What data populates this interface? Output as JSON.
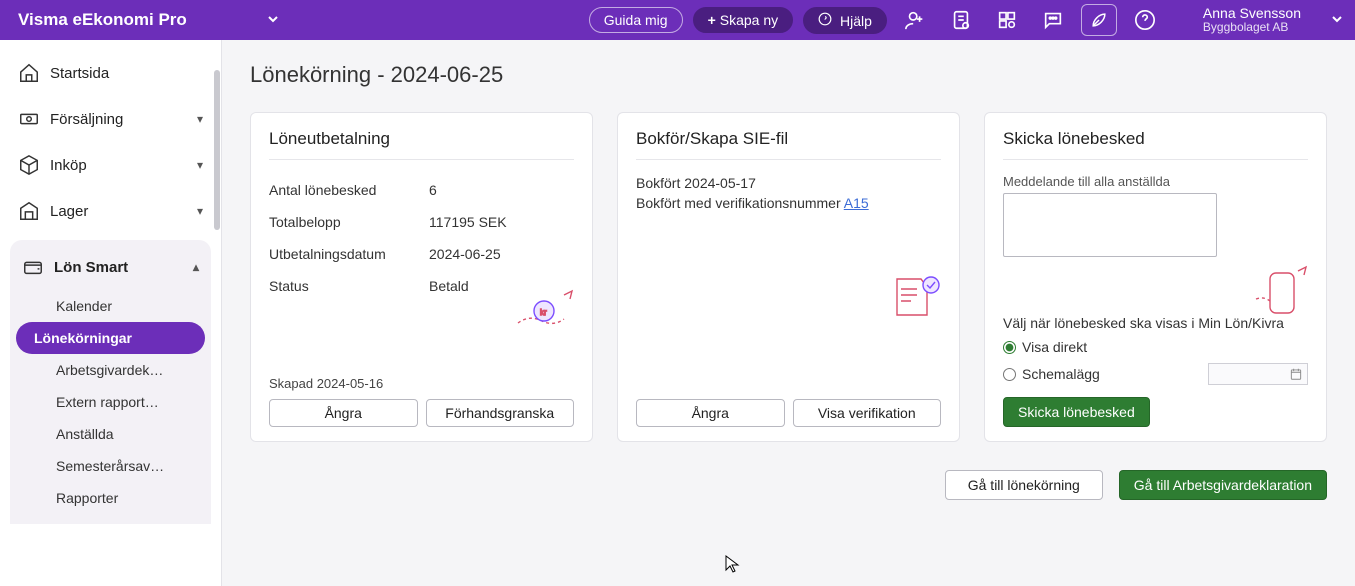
{
  "topbar": {
    "brand": "Visma eEkonomi Pro",
    "guide_btn": "Guida mig",
    "create_btn": "Skapa ny",
    "help_btn": "Hjälp",
    "user_name": "Anna Svensson",
    "user_company": "Byggbolaget AB"
  },
  "sidebar": {
    "items": [
      {
        "label": "Startsida",
        "icon": "home",
        "expandable": false
      },
      {
        "label": "Försäljning",
        "icon": "cash",
        "expandable": true
      },
      {
        "label": "Inköp",
        "icon": "package",
        "expandable": true
      },
      {
        "label": "Lager",
        "icon": "warehouse",
        "expandable": true
      }
    ],
    "group": {
      "label": "Lön Smart",
      "icon": "wallet",
      "sub": [
        {
          "label": "Kalender",
          "active": false
        },
        {
          "label": "Lönekörningar",
          "active": true
        },
        {
          "label": "Arbetsgivardek…",
          "active": false
        },
        {
          "label": "Extern rapport…",
          "active": false
        },
        {
          "label": "Anställda",
          "active": false
        },
        {
          "label": "Semesterårsav…",
          "active": false
        },
        {
          "label": "Rapporter",
          "active": false
        }
      ]
    }
  },
  "page": {
    "title": "Lönekörning - 2024-06-25",
    "card1": {
      "title": "Löneutbetalning",
      "rows": [
        {
          "lbl": "Antal lönebesked",
          "val": "6"
        },
        {
          "lbl": "Totalbelopp",
          "val": "117195 SEK"
        },
        {
          "lbl": "Utbetalningsdatum",
          "val": "2024-06-25"
        },
        {
          "lbl": "Status",
          "val": "Betald"
        }
      ],
      "created": "Skapad 2024-05-16",
      "btn_undo": "Ångra",
      "btn_preview": "Förhandsgranska"
    },
    "card2": {
      "title": "Bokför/Skapa SIE-fil",
      "line1": "Bokfört 2024-05-17",
      "line2a": "Bokfört med verifikationsnummer ",
      "line2_link": "A15",
      "btn_undo": "Ångra",
      "btn_ver": "Visa verifikation"
    },
    "card3": {
      "title": "Skicka lönebesked",
      "msg_label": "Meddelande till alla anställda",
      "choice_label": "Välj när lönebesked ska visas i Min Lön/Kivra",
      "opt_direct": "Visa direkt",
      "opt_schedule": "Schemalägg",
      "btn_send": "Skicka lönebesked"
    },
    "actions": {
      "goto_run": "Gå till lönekörning",
      "goto_decl": "Gå till Arbetsgivardeklaration"
    }
  }
}
